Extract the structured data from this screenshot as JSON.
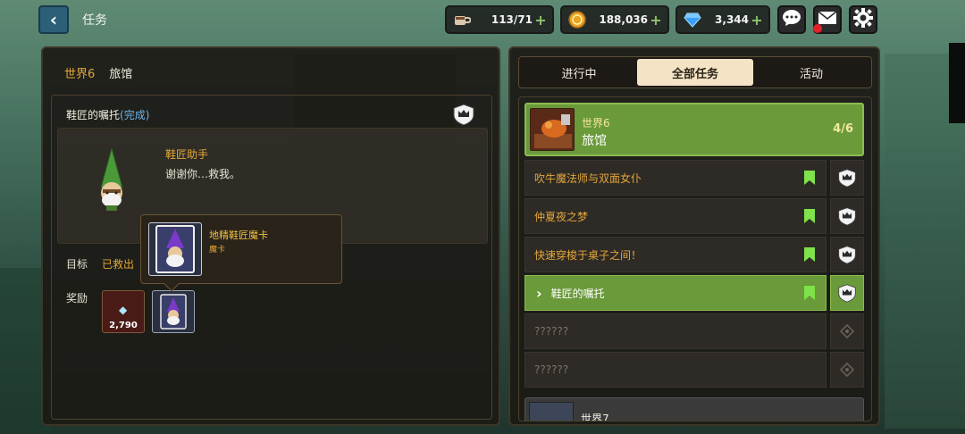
{
  "header": {
    "back_icon": "back-arrow-icon",
    "title": "任务",
    "resources": {
      "coffee": {
        "value": "113/71",
        "icon": "coffee-cup-icon"
      },
      "gold": {
        "value": "188,036",
        "icon": "gold-coin-icon"
      },
      "gem": {
        "value": "3,344",
        "icon": "gem-icon"
      }
    },
    "buttons": [
      "chat-icon",
      "mail-icon",
      "settings-icon"
    ]
  },
  "left": {
    "breadcrumb": {
      "world": "世界6",
      "area": "旅馆"
    },
    "quest_title": "鞋匠的嘱托",
    "quest_status": "(完成)",
    "npc_name": "鞋匠助手",
    "npc_line": "谢谢你…救我。",
    "goal_label": "目标",
    "goal_value": "已救出",
    "reward_label": "奖励",
    "reward_gem_count": "2,790",
    "tooltip": {
      "name": "地精鞋匠魔卡",
      "type": "魔卡"
    }
  },
  "right": {
    "tabs": [
      "进行中",
      "全部任务",
      "活动"
    ],
    "active_tab": 1,
    "world_header": {
      "world": "世界6",
      "area": "旅馆",
      "progress": "4/6"
    },
    "quests": [
      {
        "label": "吹牛魔法师与双面女仆",
        "state": "done"
      },
      {
        "label": "仲夏夜之梦",
        "state": "done"
      },
      {
        "label": "快速穿梭于桌子之间！",
        "state": "done"
      },
      {
        "label": "鞋匠的嘱托",
        "state": "selected"
      },
      {
        "label": "??????",
        "state": "locked"
      },
      {
        "label": "??????",
        "state": "locked"
      }
    ],
    "next_world": "世界7"
  },
  "colors": {
    "accent_orange": "#e3a63a",
    "selected_green": "#6a9a3a",
    "bookmark_green": "#7fe24a",
    "complete_blue": "#6fb3e8"
  }
}
